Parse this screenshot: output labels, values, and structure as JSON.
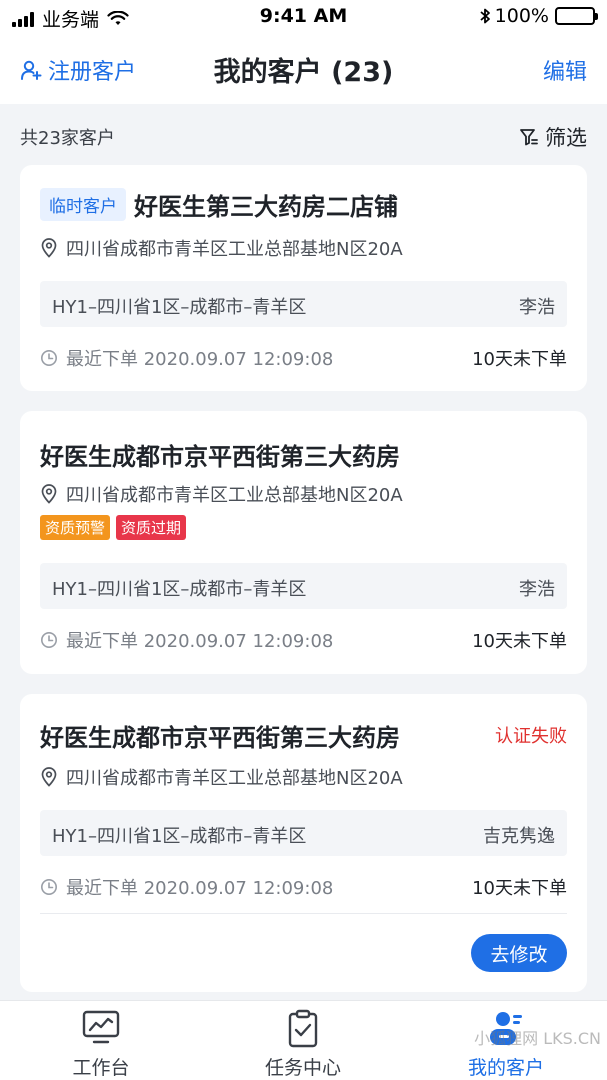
{
  "status_bar": {
    "carrier": "业务端",
    "time": "9:41 AM",
    "battery": "100%"
  },
  "navbar": {
    "register_label": "注册客户",
    "title": "我的客户 (23)",
    "edit_label": "编辑"
  },
  "summary": {
    "count_text": "共23家客户",
    "filter_label": "筛选"
  },
  "customers": [
    {
      "tag": "临时客户",
      "name": "好医生第三大药房二店铺",
      "address": "四川省成都市青羊区工业总部基地N区20A",
      "region": "HY1–四川省1区–成都市–青羊区",
      "person": "李浩",
      "last_order": "最近下单 2020.09.07 12:09:08",
      "days": "10天未下单"
    },
    {
      "name": "好医生成都市京平西街第三大药房",
      "address": "四川省成都市青羊区工业总部基地N区20A",
      "badges": [
        "资质预警",
        "资质过期"
      ],
      "region": "HY1–四川省1区–成都市–青羊区",
      "person": "李浩",
      "last_order": "最近下单 2020.09.07 12:09:08",
      "days": "10天未下单"
    },
    {
      "name": "好医生成都市京平西街第三大药房",
      "status": "认证失败",
      "address": "四川省成都市青羊区工业总部基地N区20A",
      "region": "HY1–四川省1区–成都市–青羊区",
      "person": "吉克隽逸",
      "last_order": "最近下单 2020.09.07 12:09:08",
      "days": "10天未下单",
      "action_label": "去修改"
    }
  ],
  "tabbar": {
    "items": [
      {
        "label": "工作台",
        "icon": "monitor-chart-icon"
      },
      {
        "label": "任务中心",
        "icon": "clipboard-check-icon"
      },
      {
        "label": "我的客户",
        "icon": "customers-icon",
        "active": true
      }
    ]
  },
  "watermark": "小狐狸网 LKS.CN",
  "colors": {
    "accent": "#1f6fe5",
    "danger": "#e0312f",
    "warning": "#f3951d",
    "expired": "#e8364a",
    "background": "#f2f4f7"
  }
}
